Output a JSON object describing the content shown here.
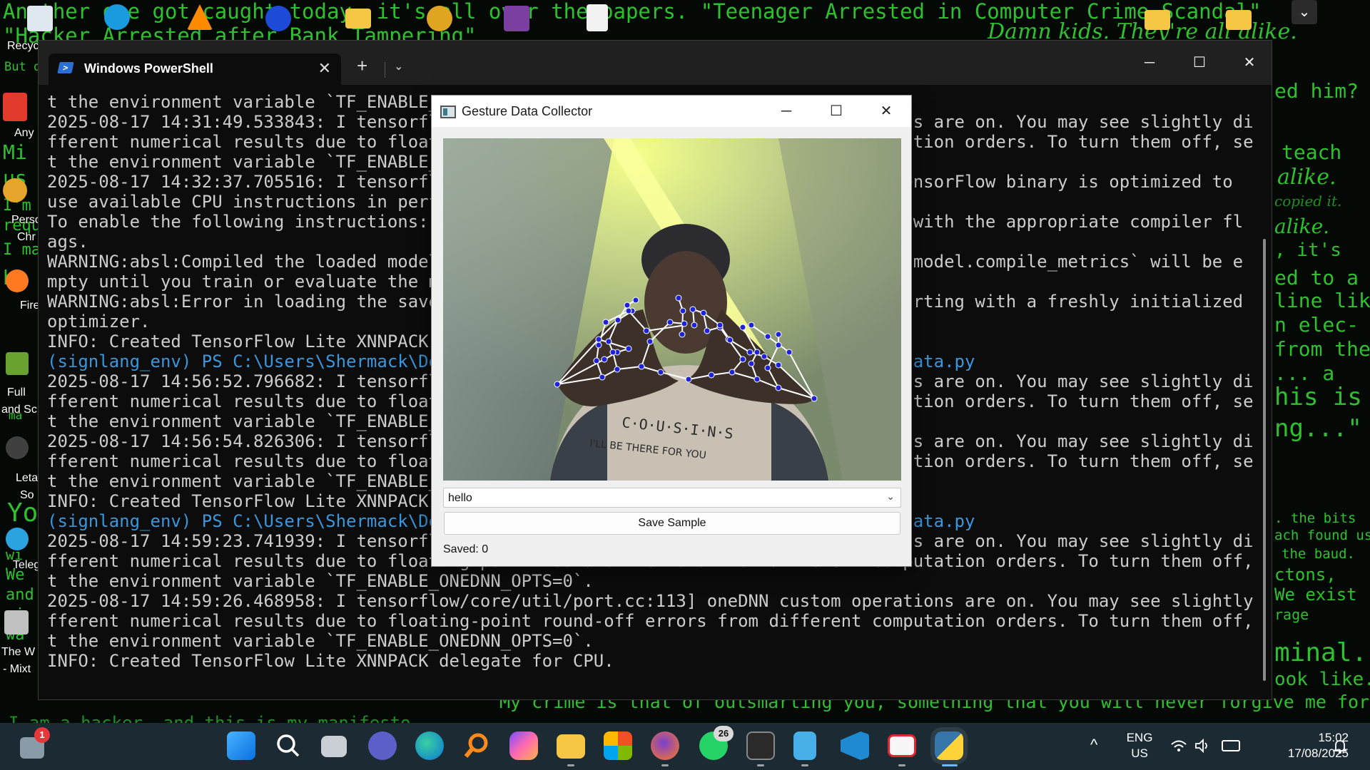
{
  "wallpaper": {
    "line1": "Another one got caught today, it's all over the papers. \"Teenager Arrested in Computer Crime Scandal\"",
    "line2": "\"Hacker Arrested after Bank Tampering\"",
    "line3": "Damn kids. They're all alike.",
    "r1": "ed him?",
    "r2": "teach",
    "r3": "alike.",
    "r4": "copied it.",
    "r5": "alike.",
    "r6": ", it's",
    "r7": "ed to a",
    "r8": "line like",
    "r9": "n elec-",
    "r10": "from the",
    "r11": "... a",
    "r12": "his is",
    "r13": "ng...\"",
    "r14": ". the bits",
    "r15": "ach found us",
    "r16": "the baud.",
    "r17": "ctons,",
    "r18": "We exist",
    "r19": "rage",
    "r20": "minal.",
    "r21": "ook like.",
    "bottom": "My crime is that of outsmarting you, something that you will never forgive me for.",
    "bottom2": "I am a hacker, and this is my manifesto.",
    "l1": "But d",
    "l2": "Mi",
    "l3": "us",
    "l4": "I'm",
    "l5": "requ",
    "l6": "I ma",
    "l7": "be",
    "l8": "ma",
    "l9": "Yo",
    "l10": "of",
    "l11": "wi",
    "l12": "We",
    "l13": "and",
    "l14": "wi",
    "l15": "wa"
  },
  "desktop_icons": [
    {
      "label": "Recyc"
    },
    {
      "label": "Any"
    },
    {
      "label": "Perso"
    },
    {
      "label": "Chr"
    },
    {
      "label": "Fire"
    },
    {
      "label": "Full"
    },
    {
      "label": "and Sc"
    },
    {
      "label": "Leta"
    },
    {
      "label": "So"
    },
    {
      "label": "Teleg"
    },
    {
      "label": "The W"
    },
    {
      "label": "- Mixt"
    }
  ],
  "terminal": {
    "tab_title": "Windows PowerShell",
    "new_tab": "+",
    "dropdown": "⌄",
    "minimize": "─",
    "maximize": "☐",
    "close": "✕",
    "lines": [
      "t the environment variable `TF_ENABLE_C",
      "2025-08-17 14:31:49.533843: I tensorflo                                            ns are on. You may see slightly di",
      "fferent numerical results due to floati                                            ation orders. To turn them off, se",
      "t the environment variable `TF_ENABLE_C",
      "2025-08-17 14:32:37.705516: I tensorflo                                           TensorFlow binary is optimized to",
      "use available CPU instructions in perfo",
      "To enable the following instructions: A                                           w with the appropriate compiler fl",
      "ags.",
      "WARNING:absl:Compiled the loaded model,                                            `model.compile_metrics` will be e",
      "mpty until you train or evaluate the mo",
      "WARNING:absl:Error in loading the saved                                            arting with a freshly initialized",
      "optimizer.",
      "INFO: Created TensorFlow Lite XNNPACK d",
      "(signlang_env) PS C:\\Users\\Shermack\\Des                                            data.py",
      "2025-08-17 14:56:52.796682: I tensorflo                                            ns are on. You may see slightly di",
      "fferent numerical results due to floati                                            ation orders. To turn them off, se",
      "t the environment variable `TF_ENABLE_C",
      "2025-08-17 14:56:54.826306: I tensorflo                                            ns are on. You may see slightly di",
      "fferent numerical results due to floati                                            ation orders. To turn them off, se",
      "t the environment variable `TF_ENABLE_C",
      "INFO: Created TensorFlow Lite XNNPACK d",
      "(signlang_env) PS C:\\Users\\Shermack\\Des                                            data.py",
      "2025-08-17 14:59:23.741939: I tensorflo                                            ns are on. You may see slightly di",
      "fferent numerical results due to floating-point round-off errors from different computation orders. To turn them off, se",
      "t the environment variable `TF_ENABLE_ONEDNN_OPTS=0`.",
      "2025-08-17 14:59:26.468958: I tensorflow/core/util/port.cc:113] oneDNN custom operations are on. You may see slightly di",
      "fferent numerical results due to floating-point round-off errors from different computation orders. To turn them off, se",
      "t the environment variable `TF_ENABLE_ONEDNN_OPTS=0`.",
      "INFO: Created TensorFlow Lite XNNPACK delegate for CPU."
    ]
  },
  "collector": {
    "title": "Gesture Data Collector",
    "minimize": "─",
    "maximize": "☐",
    "close": "✕",
    "camera_shirt_text": "C·O·U·S·I·N·S",
    "camera_shirt_text2": "I'LL BE THERE FOR YOU",
    "gesture_selected": "hello",
    "combo_arrow": "⌄",
    "save_label": "Save Sample",
    "saved_status": "Saved: 0"
  },
  "taskbar": {
    "notif_badge": "1",
    "whatsapp_badge": "26",
    "chevron": "^",
    "lang1": "ENG",
    "lang2": "US",
    "time": "15:02",
    "date": "17/08/2025",
    "icons": [
      "start-icon",
      "search-icon",
      "task-view-icon",
      "chat-icon",
      "edge-icon",
      "search-app-icon",
      "copilot-icon",
      "file-explorer-icon",
      "store-icon",
      "firefox-icon",
      "whatsapp-icon",
      "terminal-icon",
      "notepad-icon",
      "vscode-icon",
      "screen-app-icon",
      "python-icon"
    ]
  }
}
